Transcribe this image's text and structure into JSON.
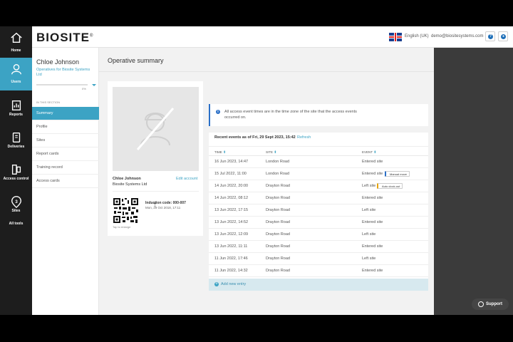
{
  "app": {
    "logo": "BIOSITE",
    "logo_mark": "®",
    "language": "English (UK)",
    "user_email": "demo@biositesystems.com"
  },
  "nav": [
    {
      "label": "Home",
      "icon": "home-icon"
    },
    {
      "label": "Users",
      "icon": "users-icon"
    },
    {
      "label": "Reports",
      "icon": "reports-icon"
    },
    {
      "label": "Deliveries",
      "icon": "deliveries-icon"
    },
    {
      "label": "Access control",
      "icon": "access-control-icon"
    },
    {
      "label": "Sites",
      "icon": "sites-icon",
      "badge": "3"
    },
    {
      "label": "All tools",
      "icon": ""
    }
  ],
  "profile": {
    "name": "Chloe Johnson",
    "company": "Operatives for Biosite Systems Ltd",
    "progress_label": "0%",
    "progress": 0
  },
  "section": {
    "label": "IN THIS SECTION",
    "items": [
      "Summary",
      "Profile",
      "Sites",
      "Report cards",
      "Training record",
      "Access cards"
    ]
  },
  "page": {
    "title": "Operative summary"
  },
  "card": {
    "name": "Chloe Johnson",
    "company": "Biosite Systems Ltd",
    "edit_label": "Edit account",
    "induction_code": "Induction code: 000-007",
    "induction_date": "Mon, 29 Oct 2018, 17:11",
    "tap_label": "Tap to enlarge"
  },
  "notice": {
    "text": "All access event times are in the time zone of the site that the access events occurred on."
  },
  "events": {
    "heading": "Recent events as of Fri, 29 Sept 2023, 15:42",
    "refresh_label": "Refresh",
    "columns": [
      "TIME",
      "SITE",
      "EVENT"
    ],
    "rows": [
      {
        "time": "16 Jun 2023, 14:47",
        "site": "London Road",
        "event": "Entered site",
        "tag": ""
      },
      {
        "time": "15 Jul 2022, 11:00",
        "site": "London Road",
        "event": "Entered site",
        "tag": "Manual move"
      },
      {
        "time": "14 Jun 2022, 20:00",
        "site": "Drayton Road",
        "event": "Left site",
        "tag": "Auto clock-out"
      },
      {
        "time": "14 Jun 2022, 08:12",
        "site": "Drayton Road",
        "event": "Entered site",
        "tag": ""
      },
      {
        "time": "13 Jun 2022, 17:15",
        "site": "Drayton Road",
        "event": "Left site",
        "tag": ""
      },
      {
        "time": "13 Jun 2022, 14:52",
        "site": "Drayton Road",
        "event": "Entered site",
        "tag": ""
      },
      {
        "time": "13 Jun 2022, 12:09",
        "site": "Drayton Road",
        "event": "Left site",
        "tag": ""
      },
      {
        "time": "13 Jun 2022, 11:11",
        "site": "Drayton Road",
        "event": "Entered site",
        "tag": ""
      },
      {
        "time": "11 Jun 2022, 17:46",
        "site": "Drayton Road",
        "event": "Left site",
        "tag": ""
      },
      {
        "time": "11 Jun 2022, 14:32",
        "site": "Drayton Road",
        "event": "Entered site",
        "tag": ""
      }
    ],
    "add_label": "Add new entry"
  },
  "support_label": "Support",
  "colors": {
    "accent": "#3ca3c4",
    "nav_bg": "#1d1d1d",
    "notice_border": "#2a6fc7",
    "manual_tag": "#2a6fc7",
    "auto_tag": "#e6a400"
  }
}
